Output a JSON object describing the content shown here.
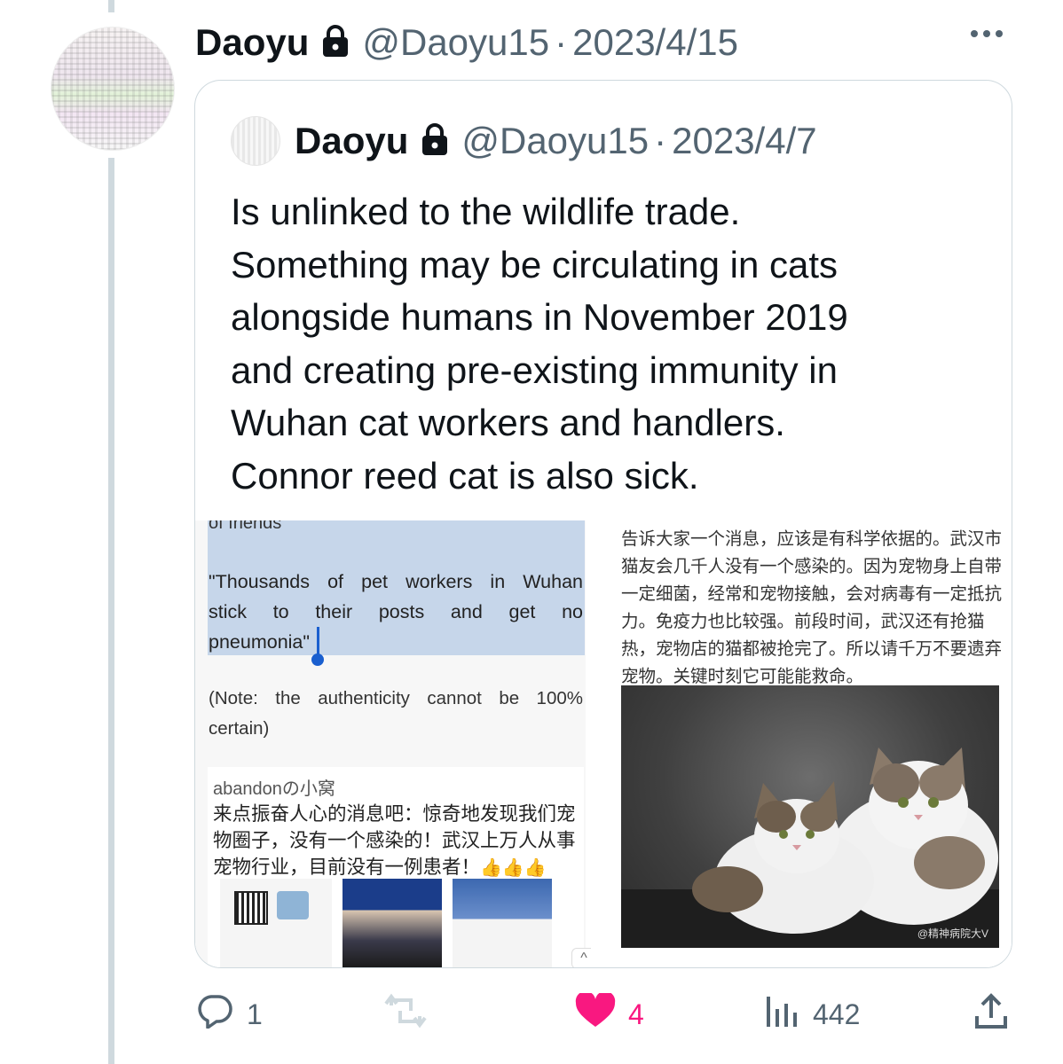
{
  "tweet": {
    "author_name": "Daoyu",
    "handle": "@Daoyu15",
    "separator": "·",
    "date": "2023/4/15"
  },
  "quote": {
    "author_name": "Daoyu",
    "handle": "@Daoyu15",
    "separator": "·",
    "date": "2023/4/7",
    "text_lines": [
      "Is unlinked to the wildlife trade.",
      "Something may be circulating in cats",
      "alongside humans in November 2019",
      "and creating pre-existing immunity in",
      "Wuhan cat workers and handlers.",
      "Connor reed cat is also sick."
    ]
  },
  "media_left": {
    "cut_line": "of friends",
    "quote_lines": [
      "\"Thousands of pet workers in Wuhan",
      "stick to their posts and get no",
      "pneumonia\""
    ],
    "note_lines": [
      "(Note: the authenticity cannot be 100%",
      "certain)"
    ],
    "card_user": "abandonの小窝",
    "card_lines": [
      "来点振奋人心的消息吧：惊奇地发现我们宠",
      "物圈子，没有一个感染的！武汉上万人从事",
      "宠物行业，目前没有一例患者！"
    ],
    "card_emoji": "👍👍👍"
  },
  "media_right": {
    "cn_lines": [
      "告诉大家一个消息，应该是有科学依据的。武汉市",
      "猫友会几千人没有一个感染的。因为宠物身上自带",
      "一定细菌，经常和宠物接触，会对病毒有一定抵抗",
      "力。免疫力也比较强。前段时间，武汉还有抢猫",
      "热，宠物店的猫都被抢完了。所以请千万不要遗弃",
      "宠物。关键时刻它可能能救命。"
    ],
    "watermark": "@精神病院大V"
  },
  "actions": {
    "replies": "1",
    "retweets": "",
    "likes": "4",
    "views": "442"
  },
  "colors": {
    "like": "#f91880",
    "muted": "#536471",
    "highlight": "#c6d6ea"
  }
}
